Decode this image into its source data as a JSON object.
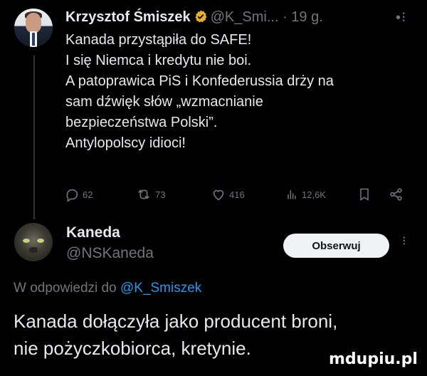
{
  "tweet": {
    "author_name": "Krzysztof Śmiszek",
    "author_handle": "@K_Smi...",
    "time": "· 19 g.",
    "lines": [
      "Kanada przystąpiła do SAFE!",
      "I się Niemca i kredytu nie boi.",
      "A patoprawica PiS i Konfederussia drży na",
      "sam dźwięk słów „wzmacnianie",
      "bezpieczeństwa Polski”.",
      "Antylopolscy idioci!"
    ],
    "stats": {
      "replies": "62",
      "retweets": "73",
      "likes": "416",
      "views": "12,6K"
    }
  },
  "reply": {
    "author_name": "Kaneda",
    "author_handle": "@NSKaneda",
    "follow_label": "Obserwuj",
    "in_reply_prefix": "W odpowiedzi do",
    "in_reply_handle": "@K_Smiszek",
    "lines": [
      "Kanada dołączyła jako producent broni,",
      "nie pożyczkobiorca, kretynie."
    ]
  },
  "watermark": "mdupiu.pl",
  "colors": {
    "background": "#000000",
    "text": "#e7e9ea",
    "muted": "#71767b",
    "link": "#1d9bf0",
    "verified_badge": "#e8b028"
  }
}
